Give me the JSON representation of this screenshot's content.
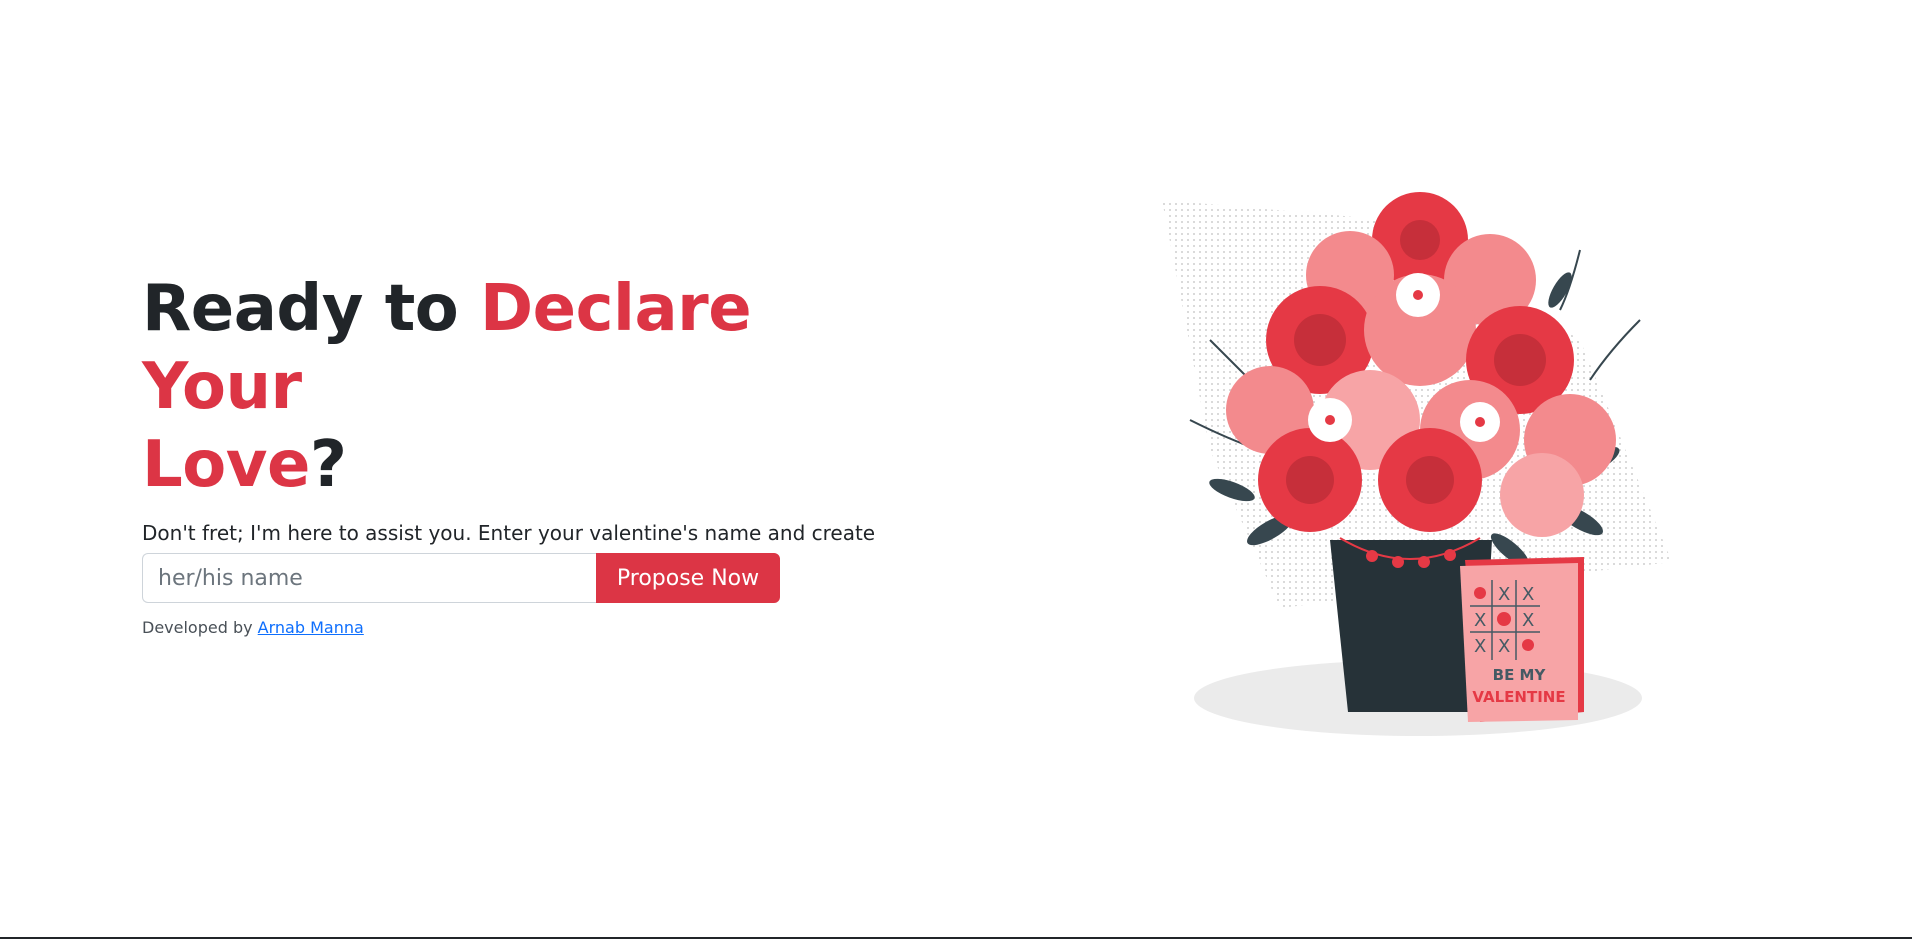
{
  "hero": {
    "headline_prefix": "Ready to ",
    "headline_accent_1": "Declare Your",
    "headline_accent_2": "Love",
    "headline_suffix": "?",
    "description": "Don't fret; I'm here to assist you. Enter your valentine's name and create a heartfelt proposal link."
  },
  "form": {
    "name_placeholder": "her/his name",
    "name_value": "",
    "submit_label": "Propose Now"
  },
  "footer": {
    "credit_prefix": "Developed by ",
    "author_name": "Arnab Manna"
  },
  "illustration": {
    "card_line_1": "BE MY",
    "card_line_2": "VALENTINE"
  },
  "colors": {
    "accent": "#dc3545",
    "text": "#212529",
    "link": "#0d6efd",
    "vase": "#263238",
    "card": "#f7a4a6"
  }
}
